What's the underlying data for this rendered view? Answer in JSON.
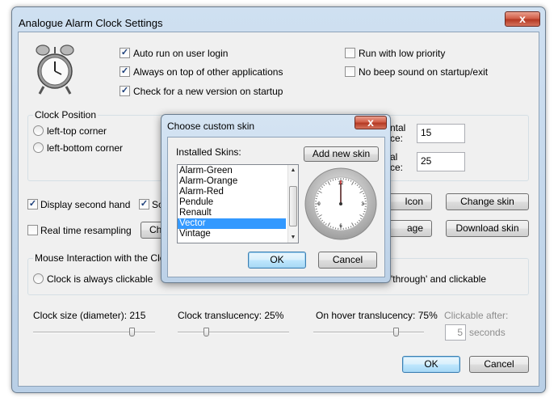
{
  "window": {
    "title": "Analogue Alarm Clock Settings",
    "close_glyph": "x"
  },
  "options": {
    "auto_run": {
      "label": "Auto run on user login",
      "checked": true
    },
    "always_on_top": {
      "label": "Always on top of other applications",
      "checked": true
    },
    "check_version": {
      "label": "Check for a new version on startup",
      "checked": true
    },
    "low_priority": {
      "label": "Run with low priority",
      "checked": false
    },
    "no_beep": {
      "label": "No beep sound on startup/exit",
      "checked": false
    }
  },
  "clock_position": {
    "label": "Clock Position",
    "left_top": "left-top corner",
    "left_bottom": "left-bottom corner",
    "horizontal_label_1": "ntal",
    "horizontal_label_2": "ce:",
    "horizontal_value": "15",
    "vertical_label_1": "al",
    "vertical_label_2": "ce:",
    "vertical_value": "25"
  },
  "display": {
    "second_hand": {
      "label": "Display second hand",
      "checked": true
    },
    "so_partial": {
      "label": "So",
      "checked": true
    },
    "realtime": {
      "label": "Real time resampling",
      "checked": false
    },
    "chi_button": "Chi",
    "icon_button": "Icon",
    "age_button": "age",
    "change_skin": "Change skin",
    "download_skin": "Download skin"
  },
  "mouse": {
    "label": "Mouse Interaction with the Clock",
    "always_clickable": "Clock is always clickable",
    "through_clickable": "'through' and clickable"
  },
  "sliders": {
    "size_label": "Clock size (diameter): 215",
    "size_value": 215,
    "translucency_label": "Clock translucency: 25%",
    "translucency_value": 25,
    "hover_label": "On hover translucency: 75%",
    "hover_value": 75
  },
  "clickable_after": {
    "label": "Clickable after:",
    "value": "5",
    "unit": "seconds"
  },
  "buttons": {
    "ok": "OK",
    "cancel": "Cancel"
  },
  "dialog": {
    "title": "Choose custom skin",
    "close_glyph": "x",
    "installed_label": "Installed Skins:",
    "add_new": "Add new skin",
    "skins": [
      {
        "name": "Alarm-Green",
        "selected": false
      },
      {
        "name": "Alarm-Orange",
        "selected": false
      },
      {
        "name": "Alarm-Red",
        "selected": false
      },
      {
        "name": "Pendule",
        "selected": false
      },
      {
        "name": "Renault",
        "selected": false
      },
      {
        "name": "Vector",
        "selected": true
      },
      {
        "name": "Vintage",
        "selected": false
      }
    ],
    "clock_numbers": [
      "12",
      "3",
      "6",
      "9"
    ],
    "ok": "OK",
    "cancel": "Cancel"
  },
  "colors": {
    "selection": "#3399ff",
    "close_red": "#c8452e",
    "frame_blue": "#bcd1e7"
  },
  "icons": {
    "app": "alarm-clock-icon",
    "scroll_up": "chevron-up-icon",
    "scroll_down": "chevron-down-icon",
    "grip": "scroll-grip-icon",
    "close": "close-icon"
  }
}
